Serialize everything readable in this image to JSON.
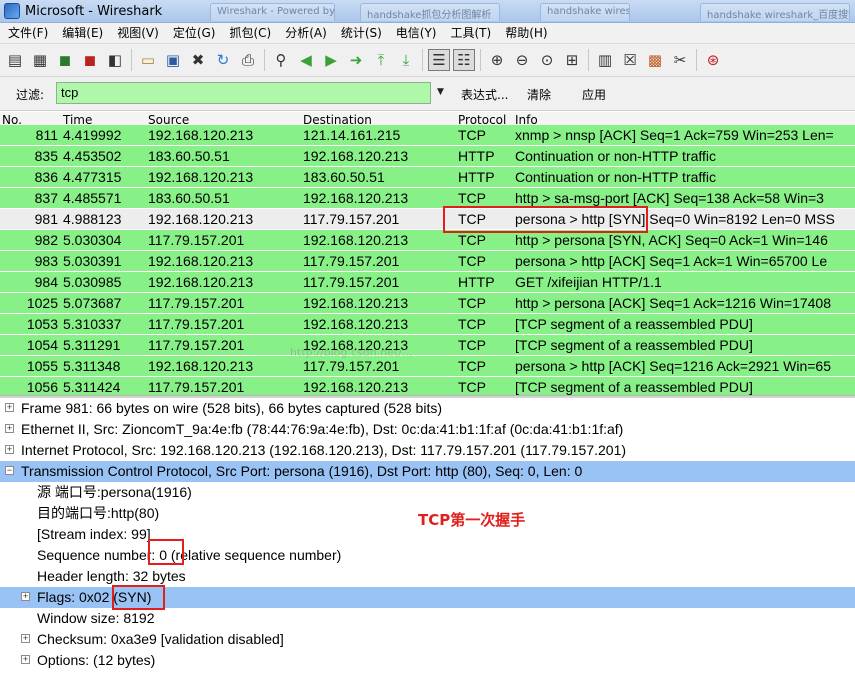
{
  "window": {
    "title": "Microsoft - Wireshark",
    "ghost_tabs": [
      "Wireshark - Powered by...",
      "handshake抓包分析图解析",
      "handshake wireshark",
      "handshake wireshark_百度搜索"
    ]
  },
  "menu": [
    "文件(F)",
    "编辑(E)",
    "视图(V)",
    "定位(G)",
    "抓包(C)",
    "分析(A)",
    "统计(S)",
    "电信(Y)",
    "工具(T)",
    "帮助(H)"
  ],
  "toolbar": {
    "icons": [
      "interfaces-icon",
      "options-icon",
      "start-capture-icon",
      "stop-capture-icon",
      "restart-capture-icon",
      "open-file-icon",
      "save-file-icon",
      "close-file-icon",
      "reload-icon",
      "print-icon",
      "find-icon",
      "go-back-icon",
      "go-forward-icon",
      "go-to-packet-icon",
      "go-first-icon",
      "go-last-icon",
      "colorize-icon",
      "autoscroll-icon",
      "zoom-in-icon",
      "zoom-out-icon",
      "zoom-normal-icon",
      "resize-columns-icon",
      "capture-filters-icon",
      "display-filters-icon",
      "coloring-rules-icon",
      "preferences-icon",
      "help-icon"
    ]
  },
  "filter": {
    "label": "过滤:",
    "value": "tcp",
    "expression_label": "表达式...",
    "clear_label": "清除",
    "apply_label": "应用"
  },
  "packet_list": {
    "columns": [
      "No.",
      "Time",
      "Source",
      "Destination",
      "Protocol",
      "Info"
    ],
    "rows": [
      {
        "no": "811",
        "time": "4.419992",
        "src": "192.168.120.213",
        "dst": "121.14.161.215",
        "proto": "TCP",
        "info": "xnmp > nnsp [ACK] Seq=1 Ack=759 Win=253 Len=",
        "style": "green"
      },
      {
        "no": "835",
        "time": "4.453502",
        "src": "183.60.50.51",
        "dst": "192.168.120.213",
        "proto": "HTTP",
        "info": "Continuation or non-HTTP traffic",
        "style": "green"
      },
      {
        "no": "836",
        "time": "4.477315",
        "src": "192.168.120.213",
        "dst": "183.60.50.51",
        "proto": "HTTP",
        "info": "Continuation or non-HTTP traffic",
        "style": "green"
      },
      {
        "no": "837",
        "time": "4.485571",
        "src": "183.60.50.51",
        "dst": "192.168.120.213",
        "proto": "TCP",
        "info": "http > sa-msg-port [ACK] Seq=138 Ack=58 Win=3",
        "style": "green"
      },
      {
        "no": "981",
        "time": "4.988123",
        "src": "192.168.120.213",
        "dst": "117.79.157.201",
        "proto": "TCP",
        "info": "persona > http [SYN] Seq=0 Win=8192 Len=0 MSS",
        "style": "sel"
      },
      {
        "no": "982",
        "time": "5.030304",
        "src": "117.79.157.201",
        "dst": "192.168.120.213",
        "proto": "TCP",
        "info": "http > persona [SYN, ACK] Seq=0 Ack=1 Win=146",
        "style": "green"
      },
      {
        "no": "983",
        "time": "5.030391",
        "src": "192.168.120.213",
        "dst": "117.79.157.201",
        "proto": "TCP",
        "info": "persona > http [ACK] Seq=1 Ack=1 Win=65700 Le",
        "style": "green"
      },
      {
        "no": "984",
        "time": "5.030985",
        "src": "192.168.120.213",
        "dst": "117.79.157.201",
        "proto": "HTTP",
        "info": "GET /xifeijian HTTP/1.1",
        "style": "green"
      },
      {
        "no": "1025",
        "time": "5.073687",
        "src": "117.79.157.201",
        "dst": "192.168.120.213",
        "proto": "TCP",
        "info": "http > persona [ACK] Seq=1 Ack=1216 Win=17408",
        "style": "green"
      },
      {
        "no": "1053",
        "time": "5.310337",
        "src": "117.79.157.201",
        "dst": "192.168.120.213",
        "proto": "TCP",
        "info": "[TCP segment of a reassembled PDU]",
        "style": "green"
      },
      {
        "no": "1054",
        "time": "5.311291",
        "src": "117.79.157.201",
        "dst": "192.168.120.213",
        "proto": "TCP",
        "info": "[TCP segment of a reassembled PDU]",
        "style": "green"
      },
      {
        "no": "1055",
        "time": "5.311348",
        "src": "192.168.120.213",
        "dst": "117.79.157.201",
        "proto": "TCP",
        "info": "persona > http [ACK] Seq=1216 Ack=2921 Win=65",
        "style": "green"
      },
      {
        "no": "1056",
        "time": "5.311424",
        "src": "117.79.157.201",
        "dst": "192.168.120.213",
        "proto": "TCP",
        "info": "[TCP segment of a reassembled PDU]",
        "style": "green"
      }
    ]
  },
  "details": [
    {
      "text": "Frame 981: 66 bytes on wire (528 bits), 66 bytes captured (528 bits)",
      "level": 0,
      "expander": "+",
      "hl": false
    },
    {
      "text": "Ethernet II, Src: ZioncomT_9a:4e:fb (78:44:76:9a:4e:fb), Dst: 0c:da:41:b1:1f:af (0c:da:41:b1:1f:af)",
      "level": 0,
      "expander": "+",
      "hl": false
    },
    {
      "text": "Internet Protocol, Src: 192.168.120.213 (192.168.120.213), Dst: 117.79.157.201 (117.79.157.201)",
      "level": 0,
      "expander": "+",
      "hl": false
    },
    {
      "text": "Transmission Control Protocol, Src Port: persona (1916), Dst Port: http (80), Seq: 0, Len: 0",
      "level": 0,
      "expander": "−",
      "hl": true
    },
    {
      "text": "源  端口号:persona(1916)",
      "level": 1,
      "expander": "",
      "hl": false
    },
    {
      "text": "目的端口号:http(80)",
      "level": 1,
      "expander": "",
      "hl": false
    },
    {
      "text": "[Stream index: 99]",
      "level": 1,
      "expander": "",
      "hl": false
    },
    {
      "text": "Sequence number: 0    (relative sequence number)",
      "level": 1,
      "expander": "",
      "hl": false
    },
    {
      "text": "Header length: 32 bytes",
      "level": 1,
      "expander": "",
      "hl": false
    },
    {
      "text": "Flags: 0x02 (SYN)",
      "level": 1,
      "expander": "+",
      "hl": true
    },
    {
      "text": "Window size: 8192",
      "level": 1,
      "expander": "",
      "hl": false
    },
    {
      "text": "Checksum: 0xa3e9 [validation disabled]",
      "level": 1,
      "expander": "+",
      "hl": false
    },
    {
      "text": "Options: (12 bytes)",
      "level": 1,
      "expander": "+",
      "hl": false
    }
  ],
  "annotation": {
    "text": "TCP第一次握手",
    "color": "#e0201c"
  },
  "colors": {
    "tcp_row": "#87f087",
    "selected_row": "#ededed",
    "tree_highlight": "#99c2f5",
    "filter_valid": "#aff8aa"
  }
}
